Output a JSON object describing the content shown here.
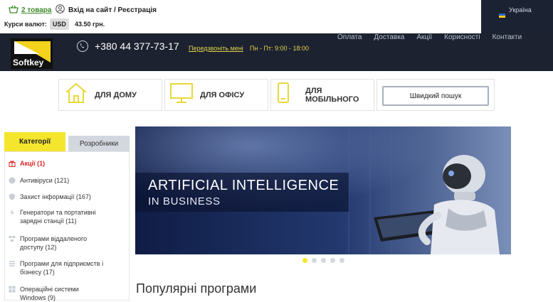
{
  "topbar": {
    "cart_label": "2 товара",
    "login_label": "Вхід на сайт / Реєстрація",
    "currency_label": "Курси валют:",
    "currency_code": "USD",
    "currency_rate": "43.50 грн.",
    "language": "Україна"
  },
  "header": {
    "logo_text": "Softkey",
    "phone": "+380 44 377-73-17",
    "callback_label": "Передзвоніть мені",
    "hours": "Пн - Пт: 9:00 - 18:00",
    "nav": [
      "Оплата",
      "Доставка",
      "Акції",
      "Корисності",
      "Контакти"
    ]
  },
  "tiles": {
    "home": "ДЛЯ ДОМУ",
    "office": "ДЛЯ ОФІСУ",
    "mobile": "ДЛЯ МОБІЛЬНОГО",
    "quick_search": "Швидкий пошук"
  },
  "sidebar": {
    "tab_categories": "Категорії",
    "tab_developers": "Розробники",
    "categories": [
      {
        "label": "Акції (1)",
        "icon": "gift-icon"
      },
      {
        "label": "Антивіруси (121)",
        "icon": "shield-icon"
      },
      {
        "label": "Захист інформації (167)",
        "icon": "shield-icon"
      },
      {
        "label": "Генератори та портативні зарядні станції (11)",
        "icon": "generator-icon"
      },
      {
        "label": "Програми віддаленого доступу (12)",
        "icon": "remote-access-icon"
      },
      {
        "label": "Програми для підприємств і бізнесу (17)",
        "icon": "list-icon"
      },
      {
        "label": "Операційні системи Windows (9)",
        "icon": "windows-icon"
      }
    ]
  },
  "banner": {
    "title": "ARTIFICIAL INTELLIGENCE",
    "subtitle": "IN BUSINESS",
    "slides": 5,
    "active_slide": 1
  },
  "section": {
    "popular_title": "Популярні програми"
  },
  "colors": {
    "accent_yellow": "#f4e52d",
    "header_dark": "#1c2230",
    "tile_icon": "#e8d83a",
    "link_green": "#3a8a2a",
    "sale_red": "#dd2222"
  }
}
